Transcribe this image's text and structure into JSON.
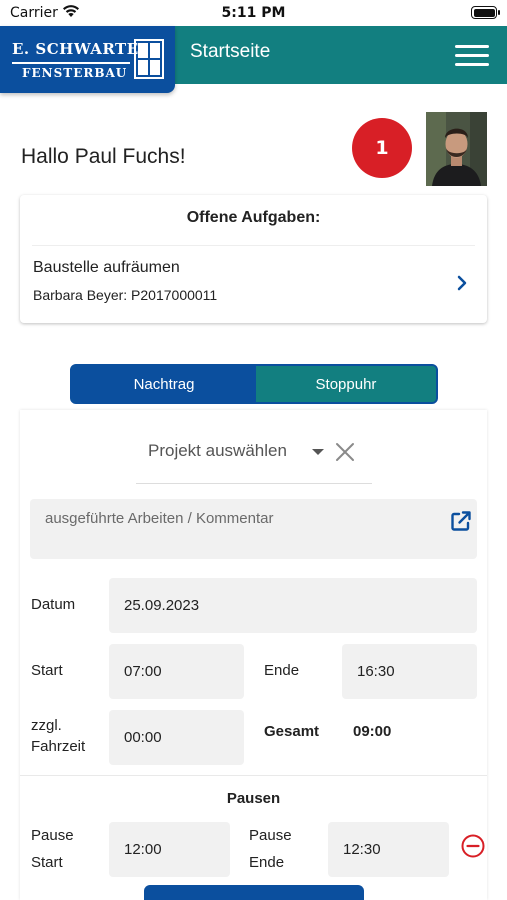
{
  "status": {
    "carrier": "Carrier",
    "time": "5:11 PM"
  },
  "logo": {
    "line1": "E. SCHWARTE",
    "line2": "FENSTERBAU"
  },
  "header": {
    "title": "Startseite"
  },
  "greeting": "Hallo Paul Fuchs!",
  "notifications": {
    "count": "1"
  },
  "tasks": {
    "heading": "Offene Aufgaben:",
    "items": [
      {
        "title": "Baustelle aufräumen",
        "subtitle": "Barbara Beyer: P2017000011"
      }
    ]
  },
  "tabs": [
    {
      "label": "Nachtrag",
      "active": true
    },
    {
      "label": "Stoppuhr",
      "active": false
    }
  ],
  "form": {
    "project_placeholder": "Projekt auswählen",
    "comment_placeholder": "ausgeführte Arbeiten / Kommentar",
    "date_label": "Datum",
    "date_value": "25.09.2023",
    "start_label": "Start",
    "start_value": "07:00",
    "end_label": "Ende",
    "end_value": "16:30",
    "travel_label_1": "zzgl.",
    "travel_label_2": "Fahrzeit",
    "travel_value": "00:00",
    "total_label": "Gesamt",
    "total_value": "09:00",
    "pauses_heading": "Pausen",
    "pause_start_label_1": "Pause",
    "pause_start_label_2": "Start",
    "pause_start_value": "12:00",
    "pause_end_label_1": "Pause",
    "pause_end_label_2": "Ende",
    "pause_end_value": "12:30"
  },
  "colors": {
    "brand_blue": "#0b4f9e",
    "brand_teal": "#127f80",
    "badge_red": "#d81f26",
    "remove_red": "#d81f26"
  },
  "icons": {
    "wifi": "wifi-icon",
    "battery": "battery-icon",
    "menu": "hamburger-menu-icon",
    "chevron": "chevron-right-icon",
    "dropdown": "caret-down-icon",
    "clear": "close-icon",
    "open_external": "external-link-icon",
    "remove": "minus-circle-icon"
  }
}
